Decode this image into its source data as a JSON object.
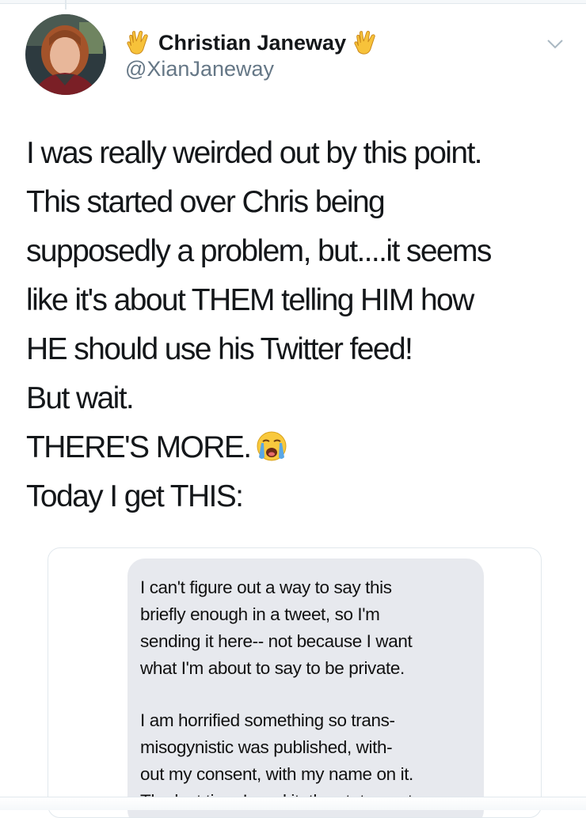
{
  "author": {
    "display_name": "Christian Janeway",
    "handle": "@XianJaneway",
    "avatar_icon": "profile-photo-avatar",
    "name_badges": [
      "vulcan-salute-emoji",
      "vulcan-salute-emoji"
    ]
  },
  "tweet": {
    "lines": [
      "I was really weirded out by this point.",
      "This started over Chris being",
      "supposedly a problem, but....it seems",
      "like it's about THEM telling HIM how",
      "HE should use his Twitter feed!",
      "But wait.",
      "THERE'S MORE.",
      "Today I get THIS:"
    ],
    "emoji": "loudly-crying-face-emoji"
  },
  "attached_image": {
    "paragraphs": [
      [
        "I can't figure out a way to say this",
        "briefly enough in a tweet, so I'm",
        "sending it here-- not because I want",
        "what I'm about to say to be private."
      ],
      [
        "I am horrified something so trans-",
        "misogynistic was published, with-",
        "out my consent, with my name on it.",
        "The last time I read it, the statement"
      ]
    ]
  },
  "icons": {
    "caret": "chevron-down-icon"
  },
  "colors": {
    "text": "#14171a",
    "secondary": "#657786",
    "bubble": "#e7e9ee",
    "border": "#e1e8ed"
  }
}
